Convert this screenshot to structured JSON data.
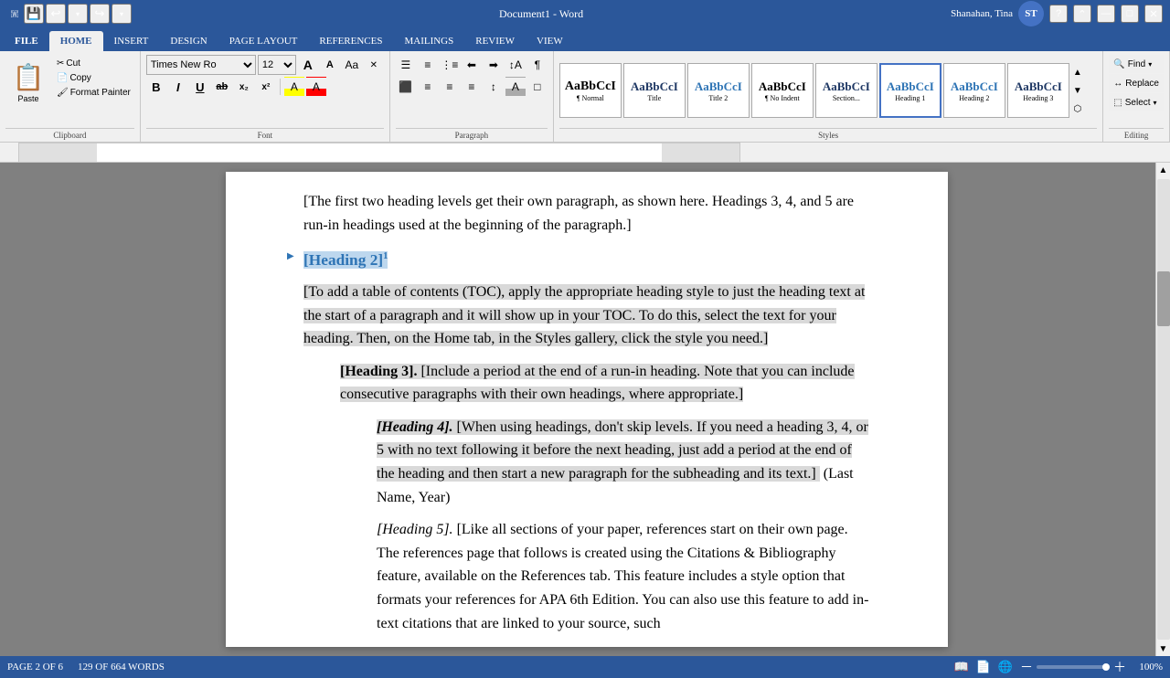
{
  "titleBar": {
    "title": "Document1 - Word",
    "userLabel": "Shanahan, Tina",
    "helpIcon": "?",
    "minimizeIcon": "—",
    "maximizeIcon": "□",
    "closeIcon": "✕"
  },
  "quickAccess": {
    "saveIcon": "💾",
    "undoIcon": "↩",
    "redoIcon": "↪",
    "dropdownIcon": "▾"
  },
  "ribbonTabs": [
    {
      "label": "FILE",
      "active": false
    },
    {
      "label": "HOME",
      "active": true
    },
    {
      "label": "INSERT",
      "active": false
    },
    {
      "label": "DESIGN",
      "active": false
    },
    {
      "label": "PAGE LAYOUT",
      "active": false
    },
    {
      "label": "REFERENCES",
      "active": false
    },
    {
      "label": "MAILINGS",
      "active": false
    },
    {
      "label": "REVIEW",
      "active": false
    },
    {
      "label": "VIEW",
      "active": false
    }
  ],
  "ribbonGroups": {
    "clipboard": {
      "label": "Clipboard",
      "pasteLabel": "Paste",
      "cutLabel": "Cut",
      "copyLabel": "Copy",
      "formatPainterLabel": "Format Painter"
    },
    "font": {
      "label": "Font",
      "fontFamily": "Times New Ro",
      "fontSize": "12",
      "boldLabel": "B",
      "italicLabel": "I",
      "underlineLabel": "U",
      "strikethroughLabel": "ab̶",
      "subscriptLabel": "x₂",
      "superscriptLabel": "x²",
      "highlightLabel": "A",
      "fontColorLabel": "A",
      "growLabel": "A↑",
      "shrinkLabel": "A↓",
      "caseLabel": "Aa",
      "clearLabel": "✕"
    },
    "paragraph": {
      "label": "Paragraph",
      "bulletsLabel": "☰",
      "numberedLabel": "1.",
      "multiListLabel": "☰",
      "decreaseIndentLabel": "←",
      "increaseIndentLabel": "→",
      "sortLabel": "↕",
      "showHideLabel": "¶",
      "alignLeftLabel": "≡",
      "centerLabel": "≡",
      "alignRightLabel": "≡",
      "justifyLabel": "≡",
      "lineSpacingLabel": "↕",
      "shadingLabel": "A",
      "borderLabel": "□"
    },
    "styles": {
      "label": "Styles",
      "items": [
        {
          "name": "Normal",
          "preview": "Aa",
          "color": "#000"
        },
        {
          "name": "Title",
          "preview": "T",
          "color": "#1f3864",
          "bold": true,
          "size": 18
        },
        {
          "name": "Title 2",
          "preview": "T",
          "color": "#2e74b5"
        },
        {
          "name": "No Indent",
          "preview": "Aa",
          "color": "#000"
        },
        {
          "name": "Section...",
          "preview": "Aa",
          "color": "#1f3864",
          "bold": true
        },
        {
          "name": "Heading 1",
          "preview": "Aa",
          "color": "#2e74b5",
          "bold": true
        },
        {
          "name": "Heading 2",
          "preview": "Aa",
          "color": "#2e74b5"
        },
        {
          "name": "Heading 3",
          "preview": "Aa",
          "color": "#1f3864"
        }
      ]
    },
    "editing": {
      "label": "Editing",
      "findLabel": "Find",
      "replaceLabel": "Replace",
      "selectLabel": "Select"
    }
  },
  "document": {
    "introText": "[The first two heading levels get their own paragraph, as shown here.  Headings 3, 4, and 5 are run-in headings used at the beginning of the paragraph.]",
    "heading2": "[Heading 2]",
    "heading2Super": "1",
    "toc_para": "[To add a table of contents (TOC), apply the appropriate heading style to just the heading text at the start of a paragraph and it will show up in your TOC.  To do this, select the text for your heading.  Then, on the Home tab, in the Styles gallery, click the style you need.]",
    "h3_label": "[Heading 3].",
    "h3_text": " [Include a period at the end of a run-in heading.  Note that you can include consecutive paragraphs with their own headings, where appropriate.]",
    "h4_label": "[Heading 4].",
    "h4_text": " [When using headings, don't skip levels.  If you need a heading 3, 4, or 5 with no text following it before the next heading, just add a period at the end of the heading and then start a new paragraph for the subheading and its text.]",
    "citation": "(Last Name, Year)",
    "h5_label": "[Heading 5].",
    "h5_text": " [Like all sections of your paper, references start on their own page.  The references page that follows is created using the Citations & Bibliography feature, available on the References tab.  This feature includes a style option that formats your references for APA 6th Edition.  You can also use this feature to add in-text citations that are linked to your source, such"
  },
  "statusBar": {
    "pageInfo": "PAGE 2 OF 6",
    "wordCount": "129 OF 664 WORDS",
    "zoomPercent": "100%"
  }
}
